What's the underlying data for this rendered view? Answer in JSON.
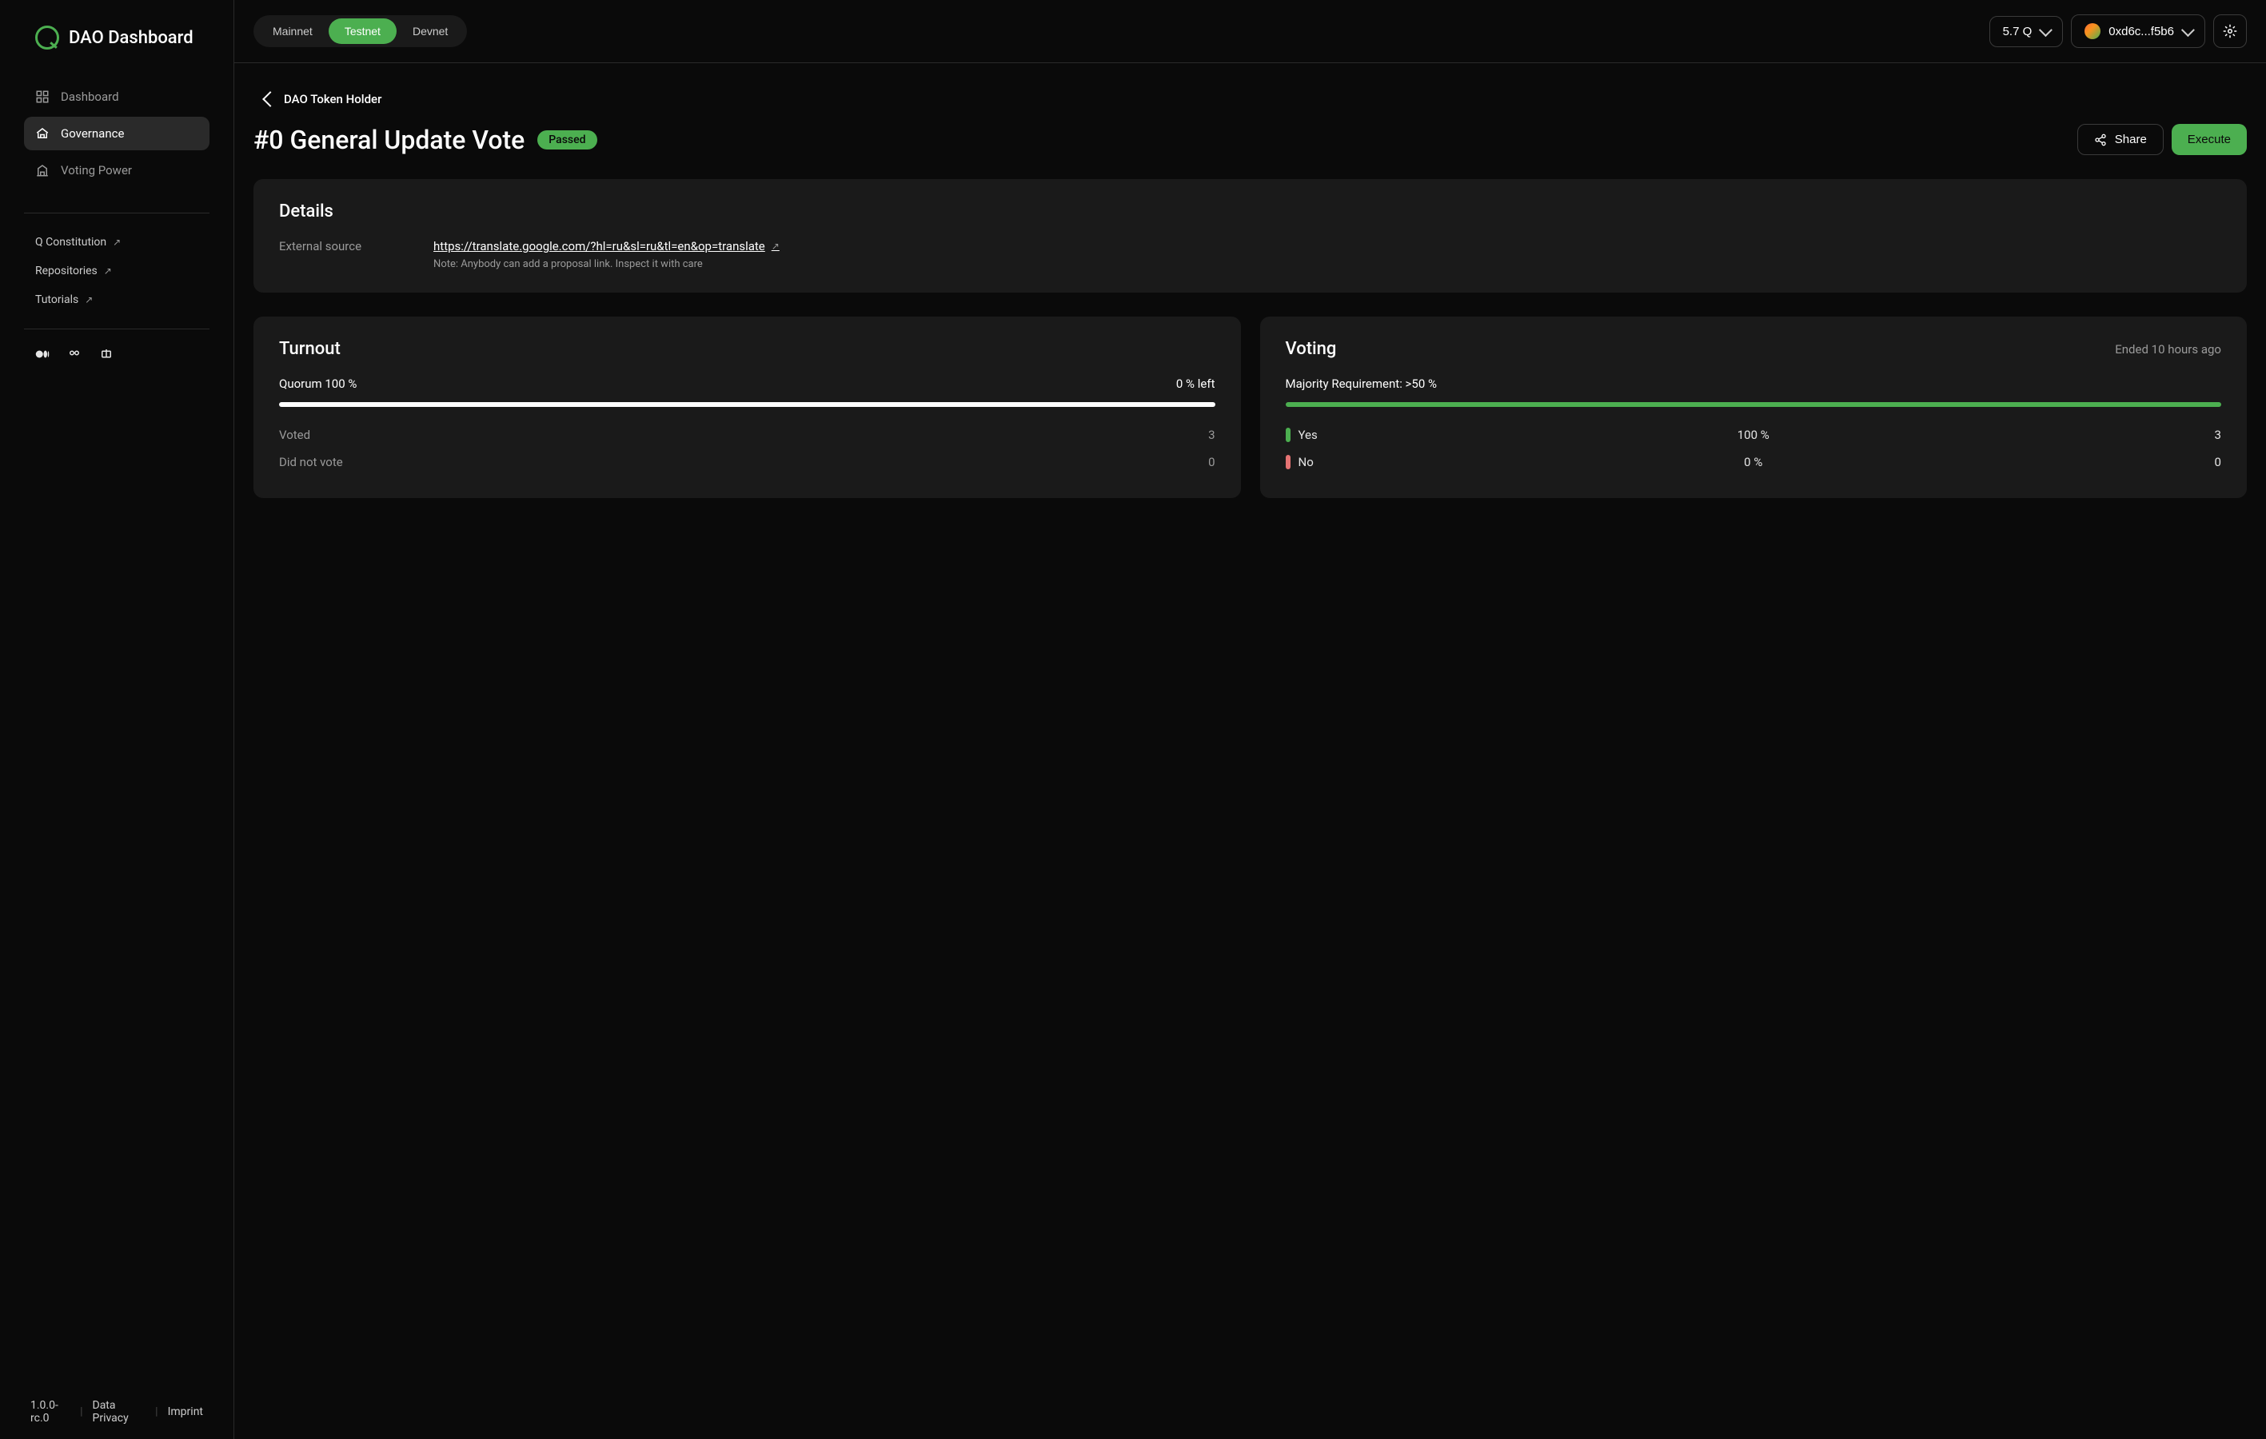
{
  "app": {
    "title": "DAO Dashboard"
  },
  "sidebar": {
    "nav": [
      {
        "label": "Dashboard",
        "active": false
      },
      {
        "label": "Governance",
        "active": true
      },
      {
        "label": "Voting Power",
        "active": false
      }
    ],
    "external": [
      {
        "label": "Q Constitution"
      },
      {
        "label": "Repositories"
      },
      {
        "label": "Tutorials"
      }
    ],
    "footer": {
      "version": "1.0.0-rc.0",
      "privacy": "Data Privacy",
      "imprint": "Imprint"
    }
  },
  "topbar": {
    "networks": [
      "Mainnet",
      "Testnet",
      "Devnet"
    ],
    "active_network": "Testnet",
    "balance": "5.7 Q",
    "wallet": "0xd6c...f5b6"
  },
  "page": {
    "back_label": "DAO Token Holder",
    "title": "#0 General Update Vote",
    "status": "Passed",
    "share_label": "Share",
    "execute_label": "Execute"
  },
  "details": {
    "title": "Details",
    "source_label": "External source",
    "source_url": "https://translate.google.com/?hl=ru&sl=ru&tl=en&op=translate",
    "note": "Note: Anybody can add a proposal link. Inspect it with care"
  },
  "turnout": {
    "title": "Turnout",
    "quorum_label": "Quorum 100 %",
    "left_label": "0 % left",
    "progress_pct": 100,
    "voted_label": "Voted",
    "voted_count": "3",
    "dnv_label": "Did not vote",
    "dnv_count": "0"
  },
  "voting": {
    "title": "Voting",
    "ended_label": "Ended 10 hours ago",
    "majority_label": "Majority Requirement: >50 %",
    "progress_pct": 100,
    "yes_label": "Yes",
    "yes_pct": "100 %",
    "yes_count": "3",
    "no_label": "No",
    "no_pct": "0 %",
    "no_count": "0"
  }
}
